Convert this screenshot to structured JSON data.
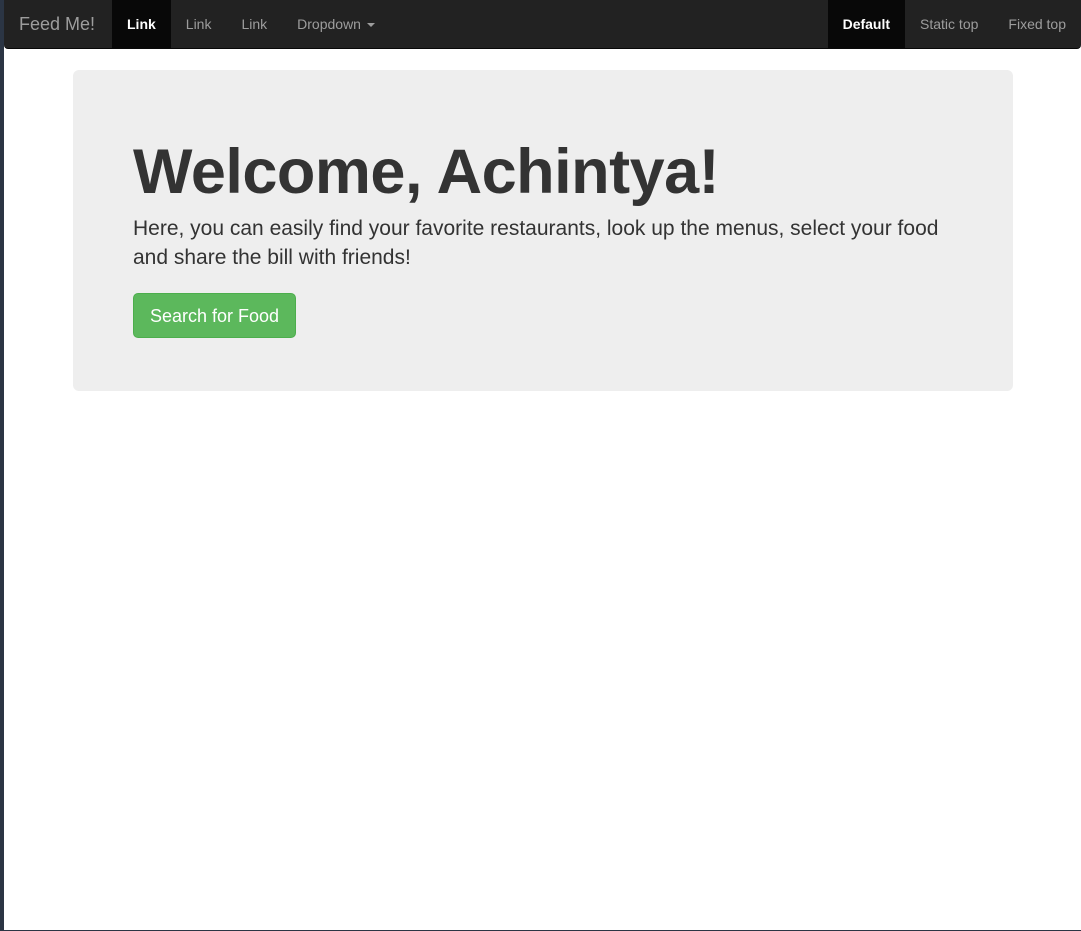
{
  "navbar": {
    "brand": "Feed Me!",
    "left_items": [
      {
        "label": "Link",
        "active": true
      },
      {
        "label": "Link",
        "active": false
      },
      {
        "label": "Link",
        "active": false
      },
      {
        "label": "Dropdown",
        "active": false
      }
    ],
    "right_items": [
      {
        "label": "Default",
        "active": true
      },
      {
        "label": "Static top",
        "active": false
      },
      {
        "label": "Fixed top",
        "active": false
      }
    ]
  },
  "hero": {
    "title": "Welcome, Achintya!",
    "description": "Here, you can easily find your favorite restaurants, look up the menus, select your food and share the bill with friends!",
    "button_label": "Search for Food"
  },
  "colors": {
    "navbar_bg": "#222222",
    "active_item_bg": "#080808",
    "jumbotron_bg": "#eeeeee",
    "success": "#5cb85c"
  },
  "icons": {
    "dropdown_indicator": "caret-down-icon"
  }
}
